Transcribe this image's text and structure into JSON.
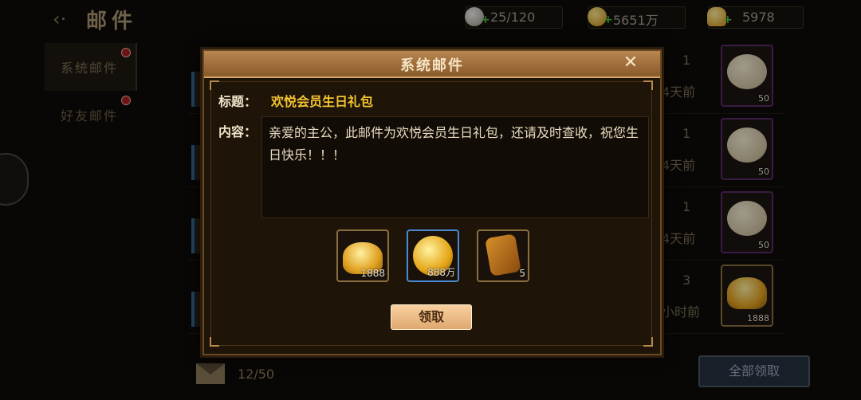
{
  "header": {
    "title": "邮件",
    "back_glyph": "‹·"
  },
  "resources": [
    {
      "name": "stamina",
      "value": "25/120",
      "color": "#b8b0a0"
    },
    {
      "name": "coins",
      "value": "5651万",
      "color": "#e0a820"
    },
    {
      "name": "ingots",
      "value": "5978",
      "color": "#e6b030"
    }
  ],
  "sidebar": {
    "tabs": [
      {
        "label": "系统邮件",
        "selected": true,
        "has_dot": true
      },
      {
        "label": "好友邮件",
        "selected": false,
        "has_dot": true
      }
    ]
  },
  "mail_list": [
    {
      "count": "1",
      "time": "4天前",
      "reward_icon": "steamed-bun",
      "reward_qty": "50"
    },
    {
      "count": "1",
      "time": "4天前",
      "reward_icon": "steamed-bun",
      "reward_qty": "50"
    },
    {
      "count": "1",
      "time": "4天前",
      "reward_icon": "steamed-bun",
      "reward_qty": "50"
    },
    {
      "count": "3",
      "time": "小时前",
      "reward_icon": "gold-ingot",
      "reward_qty": "1888"
    }
  ],
  "footer": {
    "mail_count": "12/50",
    "claim_all_label": "全部领取"
  },
  "modal": {
    "title": "系统邮件",
    "close_glyph": "✕",
    "subject_label": "标题：",
    "subject": "欢悦会员生日礼包",
    "content_label": "内容：",
    "content": "亲爱的主公，此邮件为欢悦会员生日礼包，还请及时查收，祝您生日快乐！！！",
    "items": [
      {
        "icon": "gold-ingot",
        "qty": "1888"
      },
      {
        "icon": "gold-coin",
        "qty": "888万"
      },
      {
        "icon": "token",
        "qty": "5"
      }
    ],
    "claim_label": "领取"
  }
}
